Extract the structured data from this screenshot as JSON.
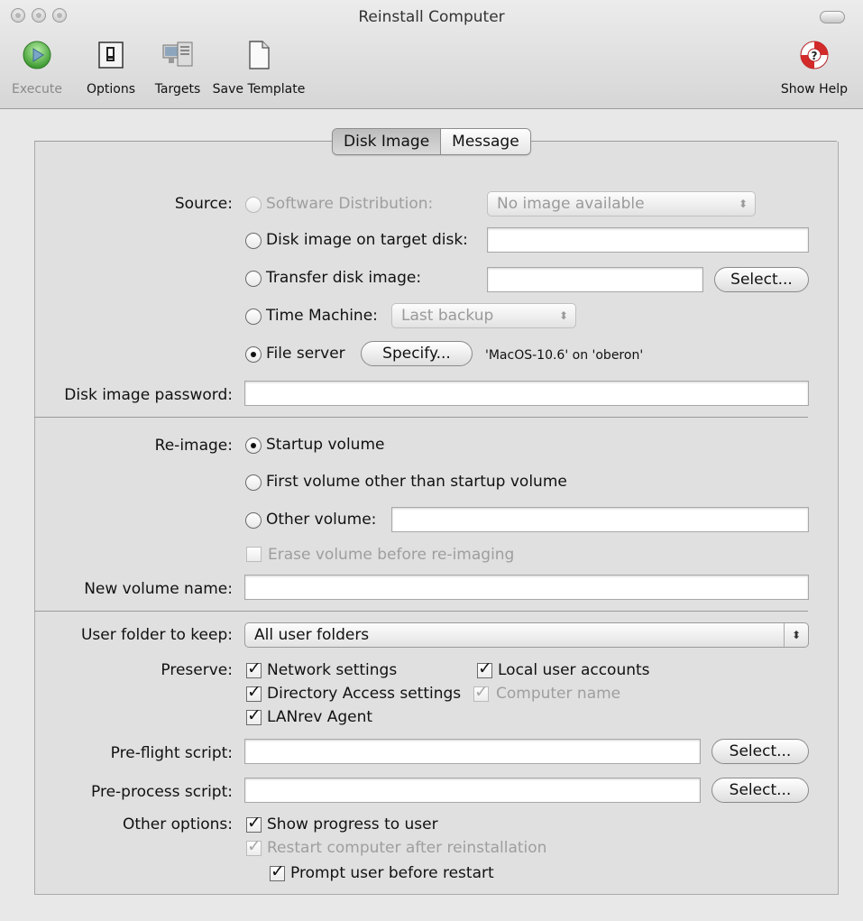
{
  "window": {
    "title": "Reinstall Computer"
  },
  "toolbar": {
    "execute": "Execute",
    "options": "Options",
    "targets": "Targets",
    "save_template": "Save Template",
    "show_help": "Show Help"
  },
  "tabs": {
    "disk_image": "Disk Image",
    "message": "Message"
  },
  "source": {
    "label": "Source:",
    "software_distribution": "Software Distribution:",
    "software_distribution_value": "No image available",
    "disk_image_on_target": "Disk image on target disk:",
    "transfer_disk_image": "Transfer disk image:",
    "select_button": "Select...",
    "time_machine": "Time Machine:",
    "time_machine_value": "Last backup",
    "file_server": "File server",
    "specify_button": "Specify...",
    "file_server_info": "'MacOS-10.6' on 'oberon'"
  },
  "disk_image_password": {
    "label": "Disk image password:",
    "value": ""
  },
  "reimage": {
    "label": "Re-image:",
    "startup_volume": "Startup volume",
    "first_volume": "First volume other than startup volume",
    "other_volume": "Other volume:",
    "erase_volume": "Erase volume before re-imaging"
  },
  "new_volume_name": {
    "label": "New volume name:",
    "value": ""
  },
  "user_folder": {
    "label": "User folder to keep:",
    "value": "All user folders"
  },
  "preserve": {
    "label": "Preserve:",
    "network_settings": "Network settings",
    "local_user_accounts": "Local user accounts",
    "directory_access": "Directory Access settings",
    "computer_name": "Computer name",
    "lanrev_agent": "LANrev Agent"
  },
  "preflight": {
    "label": "Pre-flight script:",
    "select": "Select..."
  },
  "preprocess": {
    "label": "Pre-process script:",
    "select": "Select..."
  },
  "other_options": {
    "label": "Other options:",
    "show_progress": "Show progress to user",
    "restart_after": "Restart computer after reinstallation",
    "prompt_before_restart": "Prompt user before restart"
  }
}
